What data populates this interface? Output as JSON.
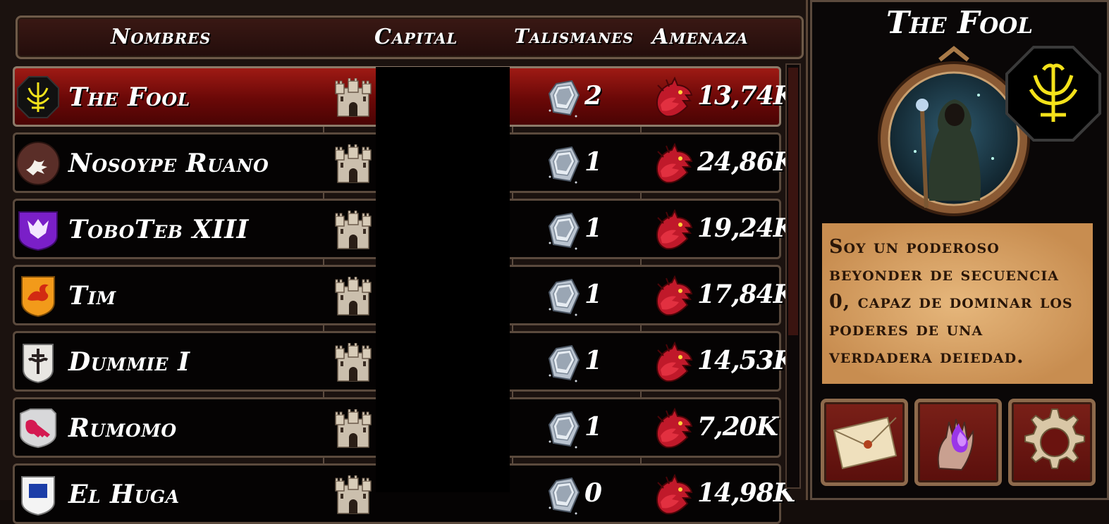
{
  "header": {
    "names": "Nombres",
    "capital": "Capital",
    "talismans": "Talismanes",
    "threat": "Amenaza"
  },
  "players": [
    {
      "name": "The Fool",
      "talismans": "2",
      "threat": "13,74K",
      "selected": true,
      "crest": "yellow-sigil-crest"
    },
    {
      "name": "Nosoype Ruano",
      "talismans": "1",
      "threat": "24,86K",
      "selected": false,
      "crest": "griffin-crest"
    },
    {
      "name": "ToboTeb XIII",
      "talismans": "1",
      "threat": "19,24K",
      "selected": false,
      "crest": "purple-dragon-crest"
    },
    {
      "name": "Tim",
      "talismans": "1",
      "threat": "17,84K",
      "selected": false,
      "crest": "orange-dragon-crest"
    },
    {
      "name": "Dummie I",
      "talismans": "1",
      "threat": "14,53K",
      "selected": false,
      "crest": "dark-cross-crest"
    },
    {
      "name": "Rumomo",
      "talismans": "1",
      "threat": "7,20K",
      "selected": false,
      "crest": "pink-key-crest"
    },
    {
      "name": "El Huga",
      "talismans": "0",
      "threat": "14,98K",
      "selected": false,
      "crest": "blue-crest"
    }
  ],
  "profile": {
    "title": "The Fool",
    "description": "Soy un poderoso beyonder de secuencia 0, capaz de dominar los poderes de una verdadera deiedad."
  },
  "actions": [
    {
      "name": "message-button",
      "icon": "envelope-icon"
    },
    {
      "name": "magic-button",
      "icon": "purple-flame-hand-icon"
    },
    {
      "name": "settings-button",
      "icon": "gear-icon"
    }
  ],
  "colors": {
    "selected_row": "#7a0b09",
    "row_bg": "#050303",
    "parchment": "#d9a468"
  }
}
